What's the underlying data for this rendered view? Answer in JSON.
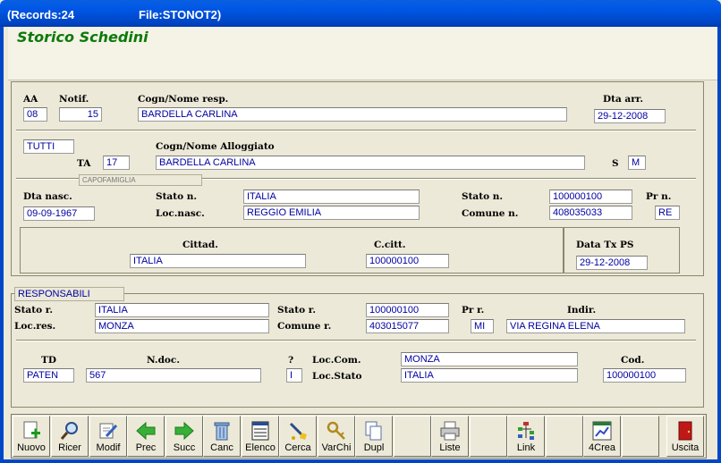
{
  "window": {
    "records_label": "(Records:24",
    "file_label": "File:STONOT2)"
  },
  "heading": "Storico Schedini",
  "section1": {
    "aa_label": "AA",
    "aa_value": "08",
    "notif_label": "Notif.",
    "notif_value": "15",
    "resp_label": "Cogn/Nome resp.",
    "resp_value": "BARDELLA CARLINA",
    "dta_arr_label": "Dta arr.",
    "dta_arr_value": "29-12-2008"
  },
  "section2": {
    "tutti_value": "TUTTI",
    "ta_label": "TA",
    "ta_value": "17",
    "alloggiato_label": "Cogn/Nome Alloggiato",
    "alloggiato_value": "BARDELLA CARLINA",
    "s_label": "S",
    "s_value": "M",
    "group_tag": "CAPOFAMIGLIA"
  },
  "section3": {
    "dta_nasc_label": "Dta nasc.",
    "dta_nasc_value": "09-09-1967",
    "stato_n_label": "Stato n.",
    "stato_n_value": "ITALIA",
    "loc_nasc_label": "Loc.nasc.",
    "loc_nasc_value": "REGGIO EMILIA",
    "stato_n_code_label": "Stato n.",
    "stato_n_code_value": "100000100",
    "comune_n_label": "Comune n.",
    "comune_n_value": "408035033",
    "pr_n_label": "Pr n.",
    "pr_n_value": "RE"
  },
  "section4": {
    "cittad_label": "Cittad.",
    "cittad_value": "ITALIA",
    "ccitt_label": "C.citt.",
    "ccitt_value": "100000100",
    "dta_tx_label": "Data Tx PS",
    "dta_tx_value": "29-12-2008"
  },
  "responsabili": {
    "tag": "RESPONSABILI",
    "stato_r_label": "Stato r.",
    "stato_r_value": "ITALIA",
    "loc_res_label": "Loc.res.",
    "loc_res_value": "MONZA",
    "stato_r_code_label": "Stato r.",
    "stato_r_code_value": "100000100",
    "comune_r_label": "Comune r.",
    "comune_r_value": "403015077",
    "pr_r_label": "Pr r.",
    "pr_r_value": "MI",
    "indir_label": "Indir.",
    "indir_value": "VIA REGINA ELENA"
  },
  "documento": {
    "td_label": "TD",
    "td_value": "PATEN",
    "ndoc_label": "N.doc.",
    "ndoc_value": "567",
    "q_label": "?",
    "q_value": "I",
    "loc_com_label": "Loc.Com.",
    "loc_com_value": "MONZA",
    "loc_stato_label": "Loc.Stato",
    "loc_stato_value": "ITALIA",
    "cod_label": "Cod.",
    "cod_value": "100000100"
  },
  "toolbar": {
    "buttons": [
      {
        "label": "Nuovo",
        "icon": "new-document-icon"
      },
      {
        "label": "Ricer",
        "icon": "magnifier-icon"
      },
      {
        "label": "Modif",
        "icon": "edit-document-icon"
      },
      {
        "label": "Prec",
        "icon": "arrow-left-icon"
      },
      {
        "label": "Succ",
        "icon": "arrow-right-icon"
      },
      {
        "label": "Canc",
        "icon": "trash-icon"
      },
      {
        "label": "Elenco",
        "icon": "list-icon"
      },
      {
        "label": "Cerca",
        "icon": "wand-icon"
      },
      {
        "label": "VarChi",
        "icon": "keys-icon"
      },
      {
        "label": "Dupl",
        "icon": "duplicate-icon"
      },
      {
        "label": "",
        "icon": ""
      },
      {
        "label": "Liste",
        "icon": "printer-icon"
      },
      {
        "label": "",
        "icon": ""
      },
      {
        "label": "Link",
        "icon": "tree-icon"
      },
      {
        "label": "",
        "icon": ""
      },
      {
        "label": "4Crea",
        "icon": "chart-icon"
      },
      {
        "label": "",
        "icon": ""
      },
      {
        "label": "Uscita",
        "icon": "exit-door-icon"
      }
    ]
  },
  "colors": {
    "title_bar": "#0058E6",
    "heading": "#0A7A0A",
    "field_text": "#0000A0"
  }
}
